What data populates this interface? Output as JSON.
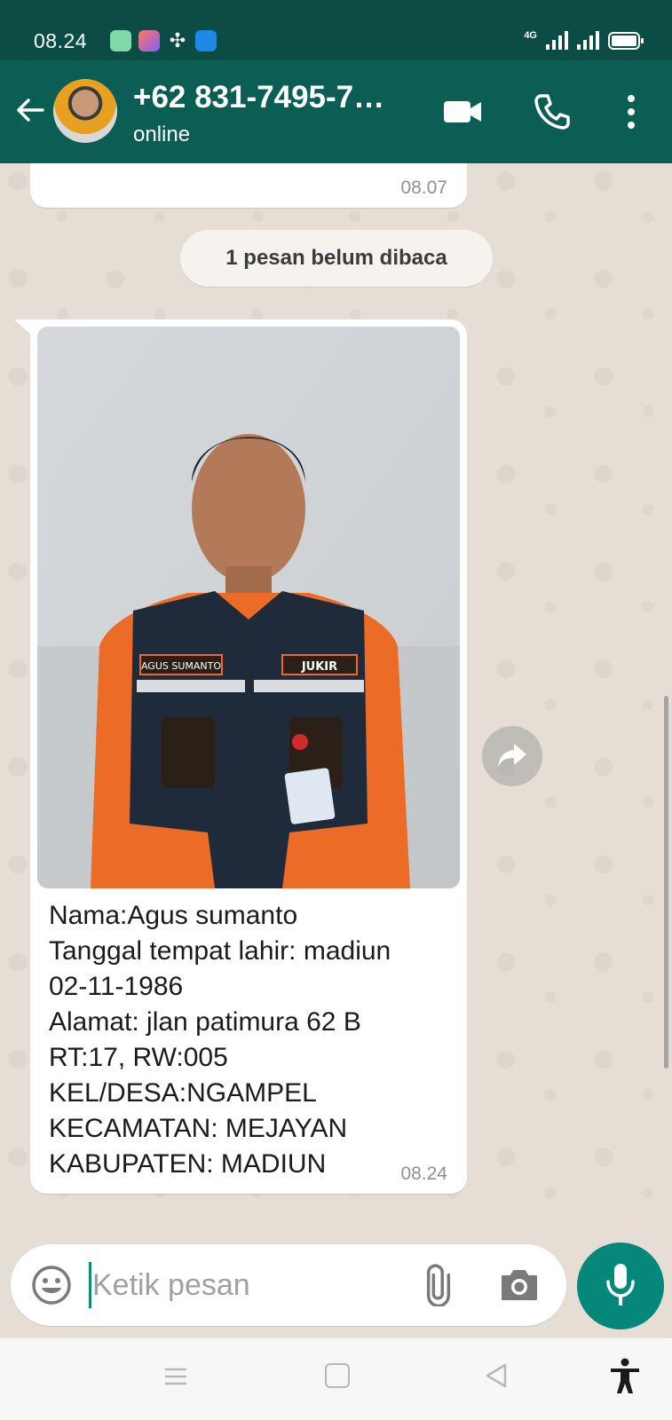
{
  "status_bar": {
    "time": "08.24",
    "network_label": "4G",
    "app_icons": [
      "gallery-app-icon",
      "color-app-icon",
      "pinwheel-app-icon",
      "blue-app-icon"
    ]
  },
  "header": {
    "contact_name": "+62 831-7495-7…",
    "contact_status": "online"
  },
  "chat": {
    "previous_message": {
      "time": "08.07"
    },
    "unread_banner": "1 pesan belum dibaca",
    "message": {
      "caption_lines": [
        "Nama:Agus sumanto",
        "Tanggal tempat lahir: madiun",
        "02-11-1986",
        "Alamat: jlan patimura 62 B",
        "RT:17, RW:005",
        "KEL/DESA:NGAMPEL",
        "KECAMATAN: MEJAYAN",
        "KABUPATEN: MADIUN"
      ],
      "time": "08.24",
      "photo_patches": {
        "left": "AGUS SUMANTO",
        "right": "JUKIR"
      }
    }
  },
  "composer": {
    "placeholder": "Ketik pesan"
  },
  "colors": {
    "status_bar": "#0b4d45",
    "header": "#0b5e54",
    "chat_background": "#e6ded5",
    "mic_button": "#05887a"
  }
}
